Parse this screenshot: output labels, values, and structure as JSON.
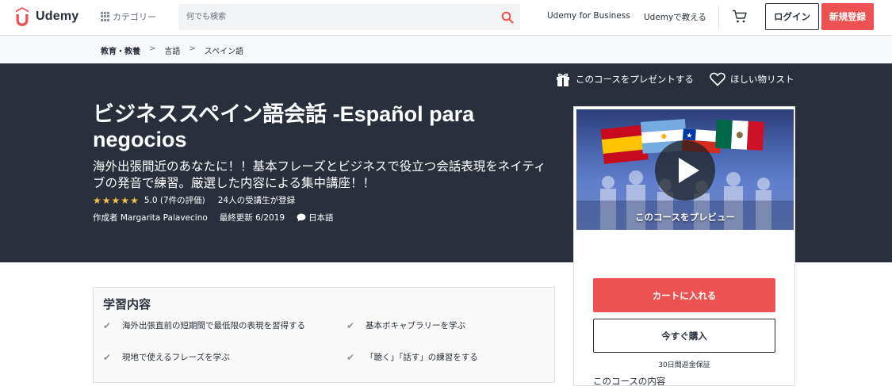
{
  "header": {
    "logo_text": "Udemy",
    "category_label": "カテゴリー",
    "search_placeholder": "何でも検索",
    "business_link": "Udemy for Business",
    "teach_link": "Udemyで教える",
    "login_label": "ログイン",
    "signup_label": "新規登録",
    "accent_color": "#ec5252"
  },
  "breadcrumb": [
    "教育・教養",
    "言語",
    "スペイン語"
  ],
  "hero": {
    "gift_label": "このコースをプレゼントする",
    "wishlist_label": "ほしい物リスト",
    "title": "ビジネススペイン語会話 -Español para negocios",
    "subtitle": "海外出張間近のあなたに！！基本フレーズとビジネスで役立つ会話表現をネイティブの発音で練習。厳選した内容による集中講座！！",
    "rating": 5,
    "rating_text": "5.0 (7件の評価)",
    "enrolled_text": "24人の受講生が登録",
    "author_text": "作成者 Margarita Palavecino",
    "updated_text": "最終更新 6/2019",
    "language_text": "日本語"
  },
  "sidebar": {
    "preview_label": "このコースをプレビュー",
    "add_to_cart_label": "カートに入れる",
    "buy_now_label": "今すぐ購入",
    "guarantee_text": "30日間返金保証",
    "includes_title": "このコースの内容"
  },
  "learn": {
    "title": "学習内容",
    "items": [
      "海外出張直前の短期間で最低限の表現を習得する",
      "基本ボキャブラリーを学ぶ",
      "現地で使えるフレーズを学ぶ",
      "「聴く」「話す」の練習をする"
    ]
  }
}
